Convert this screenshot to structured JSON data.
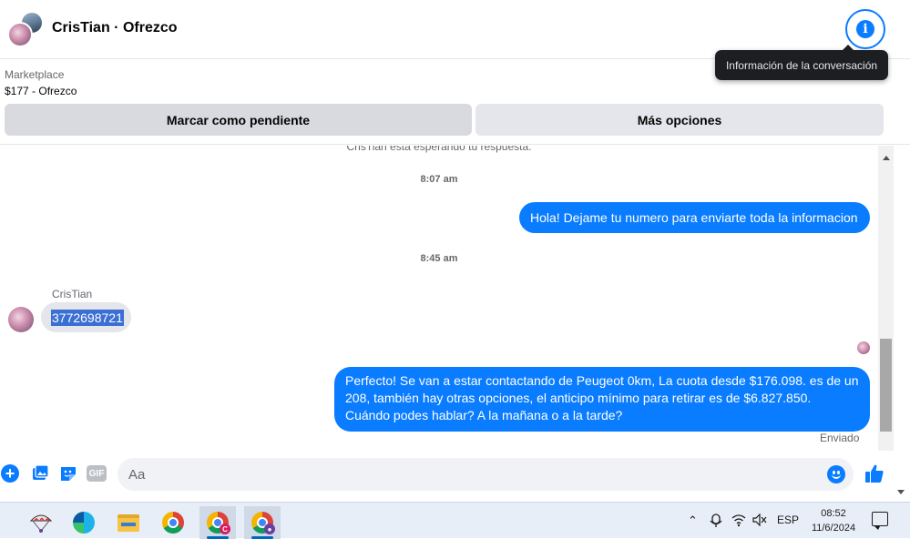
{
  "header": {
    "title": "CrisTian · Ofrezco",
    "info_icon": "info-icon",
    "tooltip": "Información de la conversación"
  },
  "marketplace": {
    "label": "Marketplace",
    "item": "$177 - Ofrezco",
    "button_pending": "Marcar como pendiente",
    "button_more": "Más opciones"
  },
  "conversation": {
    "waiting_text": "CrisTian está esperando tu respuesta.",
    "timestamp_1": "8:07 am",
    "outgoing_1": "Hola! Dejame tu numero para enviarte toda la informacion",
    "timestamp_2": "8:45 am",
    "incoming_sender": "CrisTian",
    "incoming_1": "3772698721",
    "outgoing_2": "Perfecto!  Se van a estar contactando de Peugeot 0km, La cuota desde $176.098. es de un 208, también hay otras opciones, el anticipo mínimo para retirar es de $6.827.850. Cuándo podes hablar? A la mañana o a la tarde?",
    "status": "Enviado"
  },
  "composer": {
    "placeholder": "Aa",
    "gif_label": "GIF",
    "icons": [
      "plus-icon",
      "image-icon",
      "sticker-icon",
      "gif-icon",
      "emoji-icon",
      "like-icon"
    ]
  },
  "taskbar": {
    "language": "ESP",
    "time": "08:52",
    "date": "11/6/2024",
    "badge_1": "C",
    "icons": [
      "parachute-app-icon",
      "edge-icon",
      "file-explorer-icon",
      "chrome-icon",
      "chrome-profile-icon",
      "chrome-profile-active-icon"
    ]
  },
  "colors": {
    "accent": "#0a7cff",
    "bubble_in": "#e4e6eb",
    "secondary_text": "#65676b"
  }
}
